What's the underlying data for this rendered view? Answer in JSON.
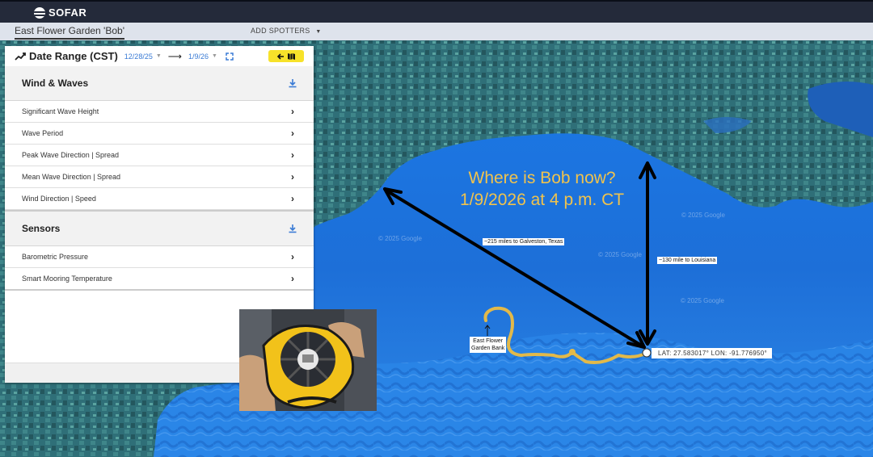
{
  "app": {
    "brand": "SOFAR"
  },
  "subbar": {
    "spotter_name": "East Flower Garden 'Bob'",
    "add_spotters": "ADD SPOTTERS"
  },
  "panel": {
    "title": "Date Range (CST)",
    "start_date": "12/28/25",
    "end_date": "1/9/26",
    "sections": [
      {
        "title": "Wind & Waves",
        "items": [
          "Significant Wave Height",
          "Wave Period",
          "Peak Wave Direction | Spread",
          "Mean Wave Direction | Spread",
          "Wind Direction | Speed"
        ]
      },
      {
        "title": "Sensors",
        "items": [
          "Barometric Pressure",
          "Smart Mooring Temperature"
        ]
      }
    ]
  },
  "map": {
    "headline_line1": "Where is Bob now?",
    "headline_line2": "1/9/2026 at 4 p.m. CT",
    "label_galveston": "~215 miles to Galveston, Texas",
    "label_louisiana": "~130 mile to Louisiana",
    "label_efgb_1": "East Flower",
    "label_efgb_2": "Garden Bank",
    "latlon": "LAT: 27.583017°   LON: -91.776950°",
    "watermark": "© 2025 Google",
    "colors": {
      "headline": "#f0c34d",
      "track": "#e2b94a",
      "arrow": "#000000",
      "accent_button": "#f7e22a",
      "link_blue": "#3a7bd5"
    }
  }
}
